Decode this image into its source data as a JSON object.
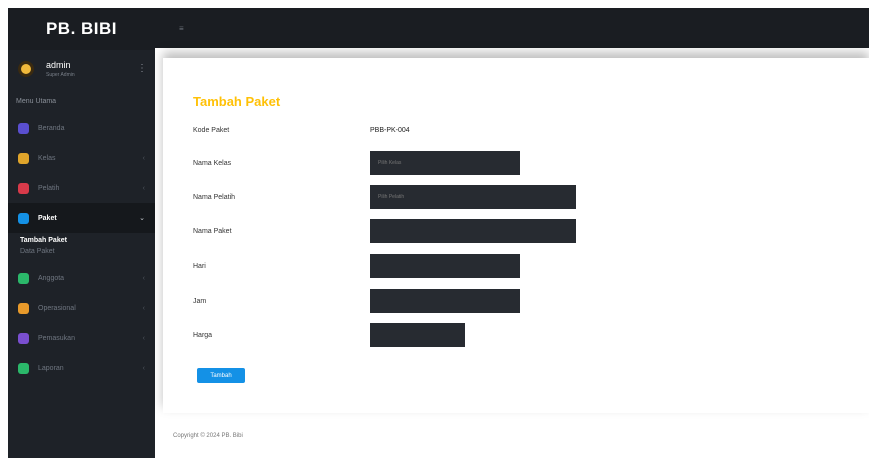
{
  "brand": "PB. BIBI",
  "user": {
    "name": "admin",
    "role": "Super Admin"
  },
  "menu_header": "Menu Utama",
  "sidebar": {
    "items": [
      {
        "label": "Beranda",
        "icon": "home-icon",
        "color": "#5a4fcf"
      },
      {
        "label": "Kelas",
        "icon": "class-icon",
        "color": "#e0a52b"
      },
      {
        "label": "Pelatih",
        "icon": "coach-icon",
        "color": "#d83a4a"
      },
      {
        "label": "Paket",
        "icon": "package-icon",
        "color": "#1491e6",
        "active": true
      },
      {
        "label": "Anggota",
        "icon": "members-icon",
        "color": "#2bb86a"
      },
      {
        "label": "Operasional",
        "icon": "operational-icon",
        "color": "#e89a2b"
      },
      {
        "label": "Pemasukan",
        "icon": "income-icon",
        "color": "#7a4fd0"
      },
      {
        "label": "Laporan",
        "icon": "report-icon",
        "color": "#2bb86a"
      }
    ],
    "submenu": [
      "Tambah Paket",
      "Data Paket"
    ]
  },
  "page_title": "Tambah Paket",
  "form": {
    "kode_label": "Kode Paket",
    "kode_value": "PBB-PK-004",
    "kelas_label": "Nama Kelas",
    "kelas_placeholder": "Pilih Kelas",
    "pelatih_label": "Nama Pelatih",
    "pelatih_placeholder": "Pilih Pelatih",
    "paket_label": "Nama Paket",
    "hari_label": "Hari",
    "jam_label": "Jam",
    "harga_label": "Harga",
    "submit_label": "Tambah"
  },
  "footer": "Copyright © 2024 PB. Bibi"
}
